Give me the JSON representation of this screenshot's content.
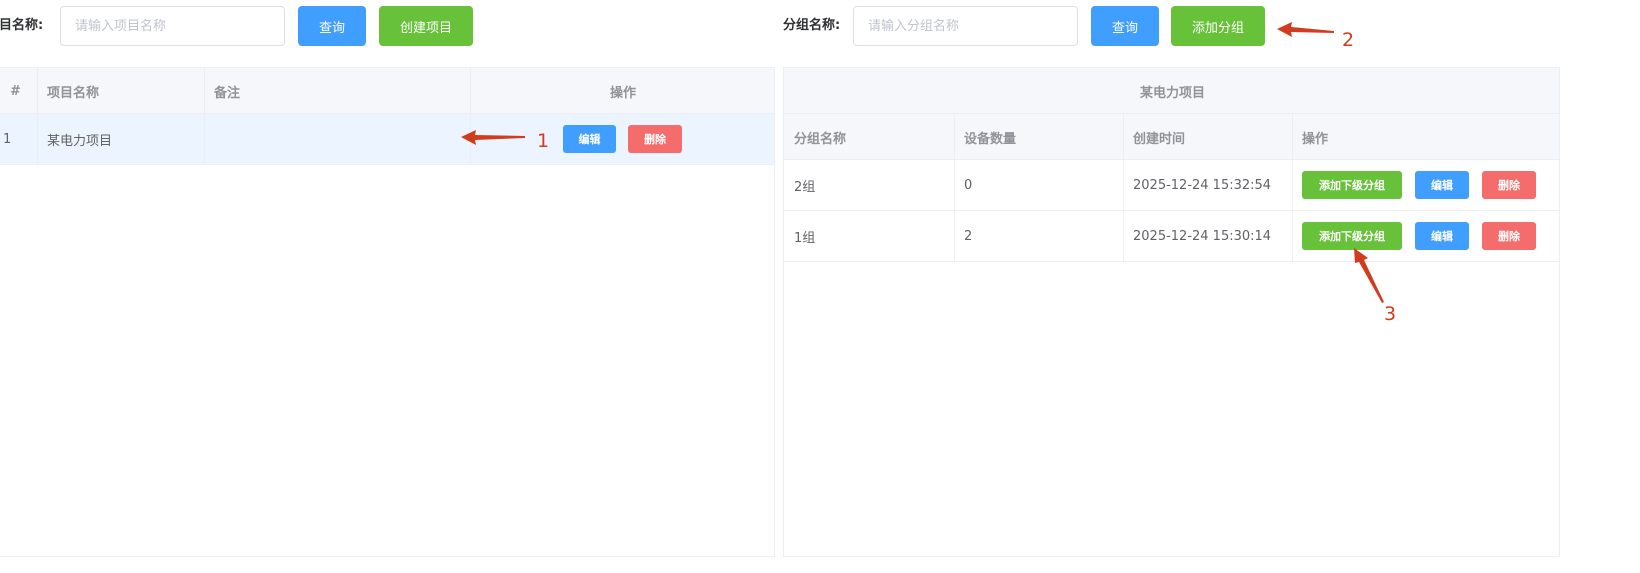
{
  "left": {
    "search": {
      "label": "项目名称:",
      "placeholder": "请输入项目名称",
      "query_button": "查询",
      "create_button": "创建项目"
    },
    "table": {
      "headers": [
        "#",
        "项目名称",
        "备注",
        "操作"
      ],
      "rows": [
        {
          "index": "1",
          "name": "某电力项目",
          "note": "",
          "edit": "编辑",
          "delete": "删除"
        }
      ]
    }
  },
  "right": {
    "search": {
      "label": "分组名称:",
      "placeholder": "请输入分组名称",
      "query_button": "查询",
      "add_button": "添加分组"
    },
    "table": {
      "title": "某电力项目",
      "headers": [
        "分组名称",
        "设备数量",
        "创建时间",
        "操作"
      ],
      "rows": [
        {
          "name": "2组",
          "count": "0",
          "created": "2025-12-24 15:32:54",
          "add_sub": "添加下级分组",
          "edit": "编辑",
          "delete": "删除"
        },
        {
          "name": "1组",
          "count": "2",
          "created": "2025-12-24 15:30:14",
          "add_sub": "添加下级分组",
          "edit": "编辑",
          "delete": "删除"
        }
      ]
    }
  },
  "annotations": [
    "1",
    "2",
    "3"
  ],
  "colors": {
    "primary": "#409eff",
    "success": "#67c23a",
    "danger": "#f56c6c",
    "annotation": "#d23c1e"
  }
}
